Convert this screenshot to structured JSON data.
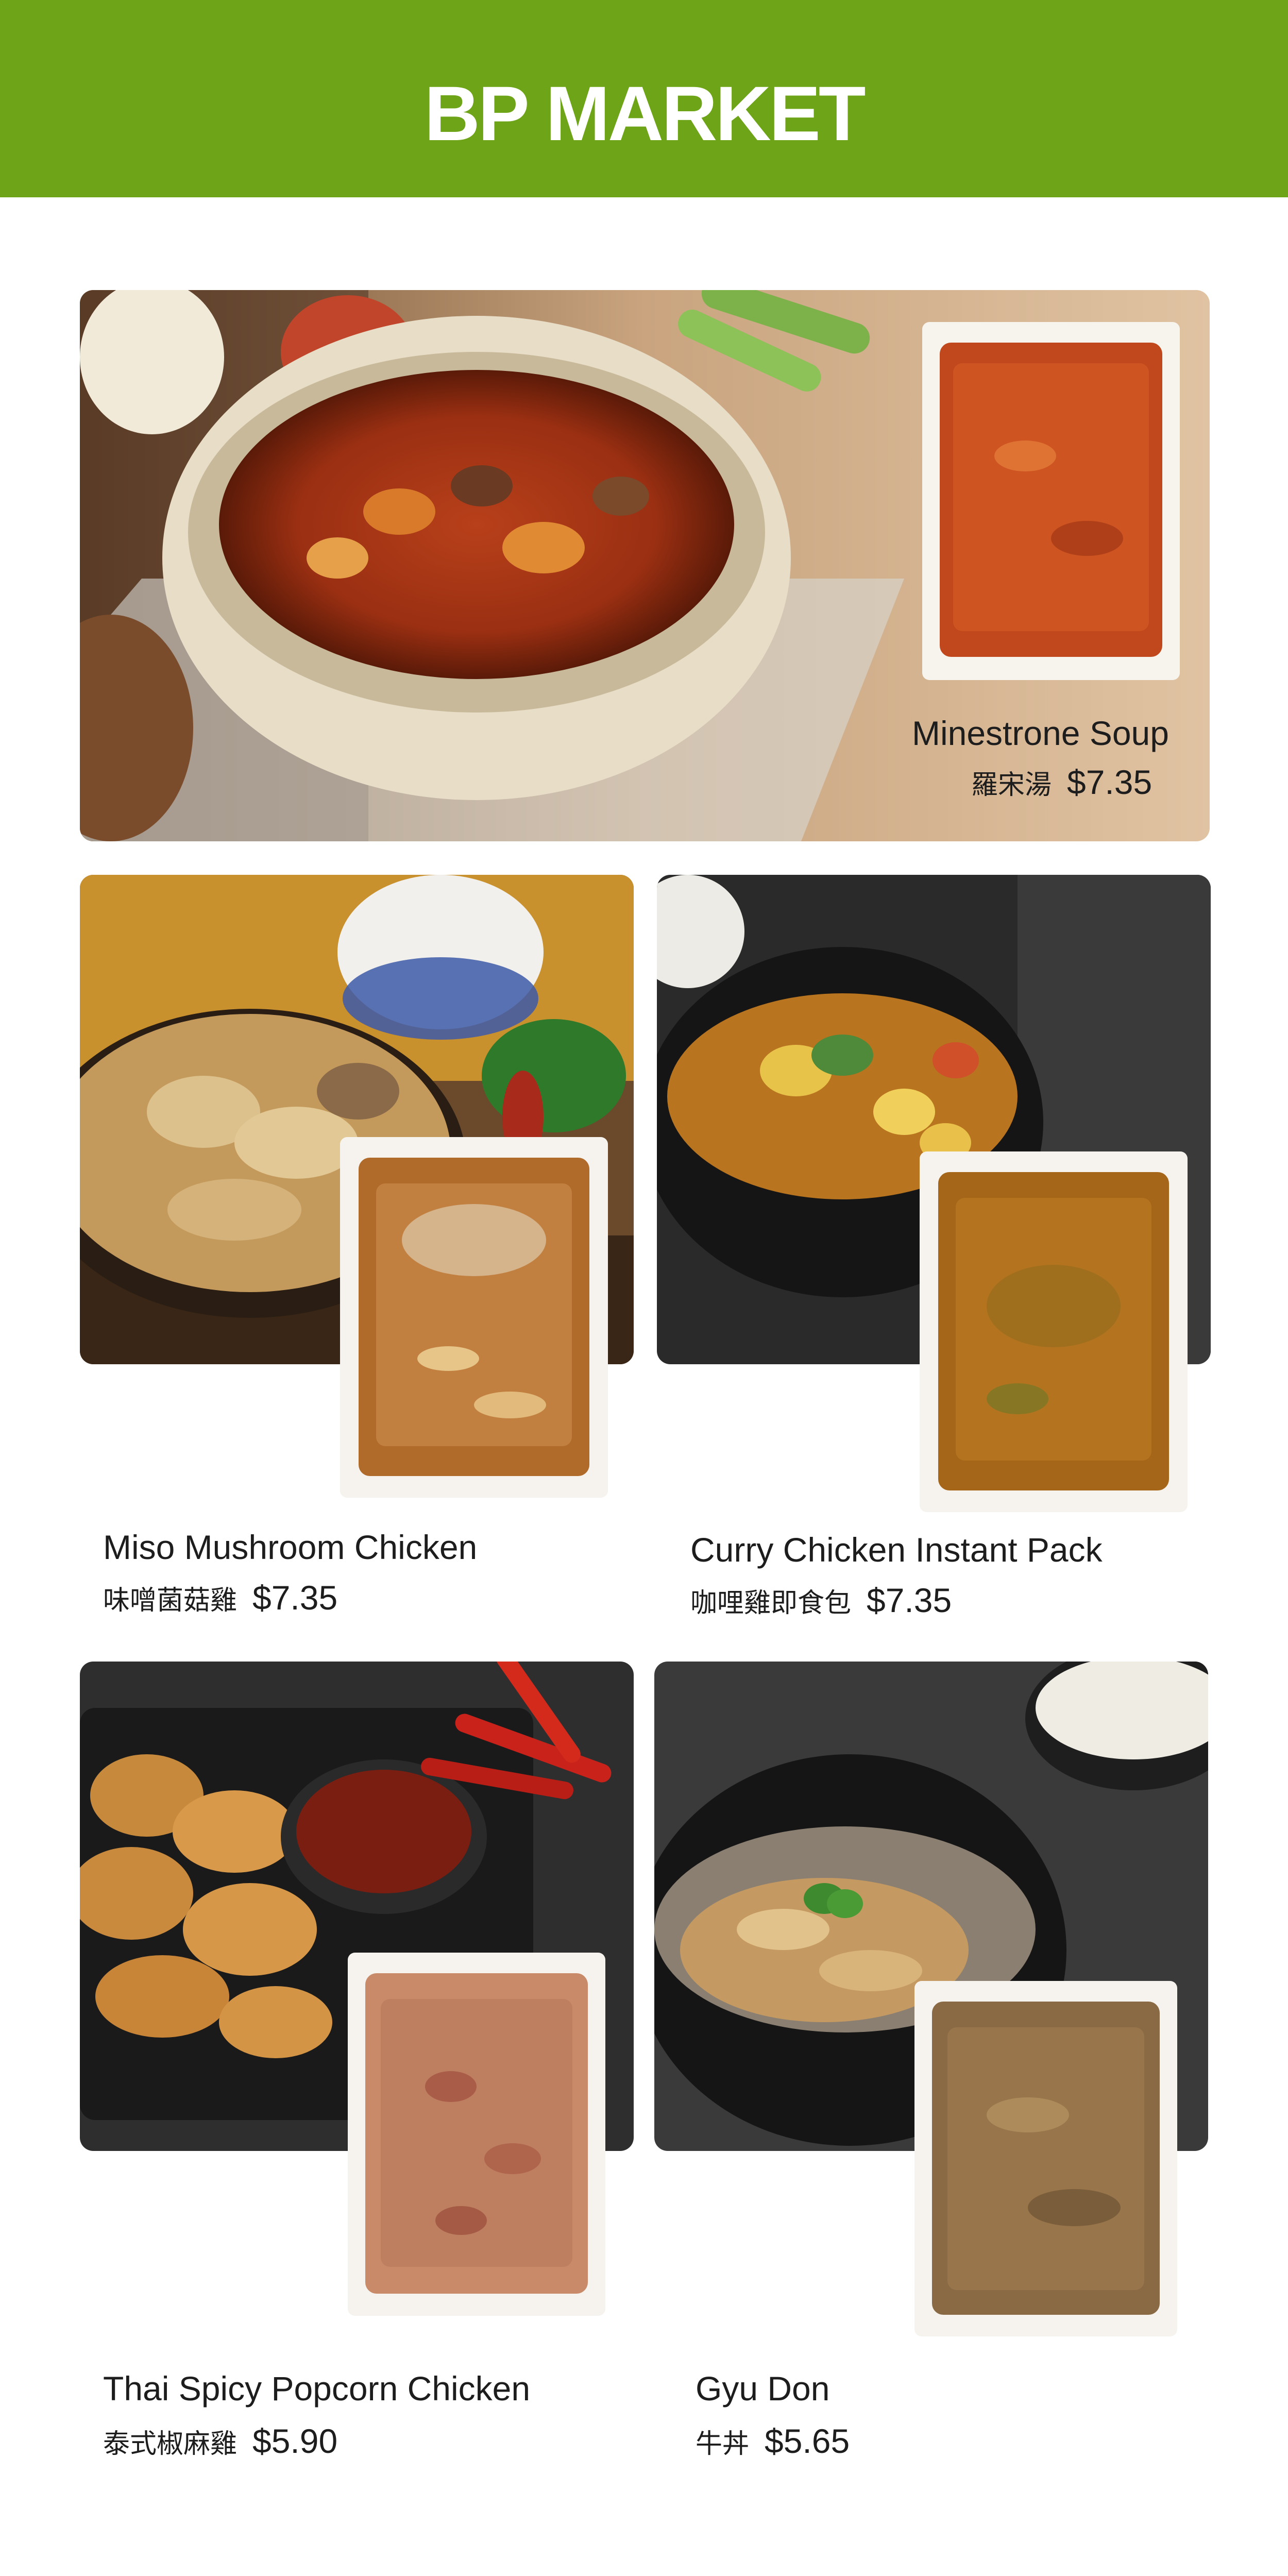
{
  "brand": {
    "logo_text": "BP MARKET",
    "header_color": "#6ea417"
  },
  "products": [
    {
      "name": "Minestrone Soup",
      "name_zh": "羅宋湯",
      "price": "$7.35"
    },
    {
      "name": "Miso Mushroom Chicken",
      "name_zh": "味噌菌菇雞",
      "price": "$7.35"
    },
    {
      "name": "Curry Chicken Instant Pack",
      "name_zh": "咖哩雞即食包",
      "price": "$7.35"
    },
    {
      "name": "Thai Spicy Popcorn Chicken",
      "name_zh": "泰式椒麻雞",
      "price": "$5.90"
    },
    {
      "name": "Gyu Don",
      "name_zh": "牛丼",
      "price": "$5.65"
    }
  ]
}
